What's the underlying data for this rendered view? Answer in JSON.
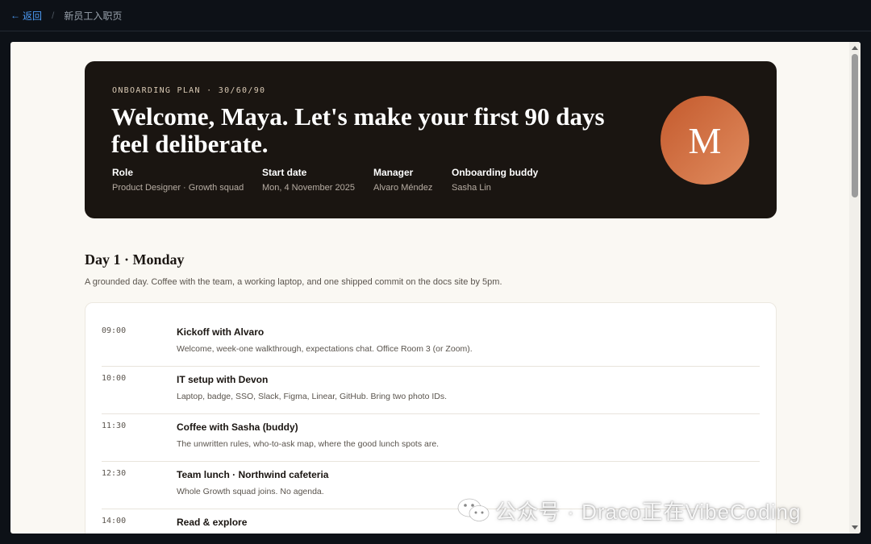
{
  "nav": {
    "back_label": "返回",
    "breadcrumb": "新员工入职页"
  },
  "hero": {
    "eyebrow": "ONBOARDING PLAN · 30/60/90",
    "title": "Welcome, Maya. Let's make your first 90 days feel deliberate.",
    "avatar_initial": "M",
    "meta": [
      {
        "label": "Role",
        "value": "Product Designer · Growth squad"
      },
      {
        "label": "Start date",
        "value": "Mon, 4 November 2025"
      },
      {
        "label": "Manager",
        "value": "Alvaro Méndez"
      },
      {
        "label": "Onboarding buddy",
        "value": "Sasha Lin"
      }
    ]
  },
  "day": {
    "title": "Day 1 · Monday",
    "subtitle": "A grounded day. Coffee with the team, a working laptop, and one shipped commit on the docs site by 5pm.",
    "events": [
      {
        "time": "09:00",
        "title": "Kickoff with Alvaro",
        "desc": "Welcome, week-one walkthrough, expectations chat. Office Room 3 (or Zoom)."
      },
      {
        "time": "10:00",
        "title": "IT setup with Devon",
        "desc": "Laptop, badge, SSO, Slack, Figma, Linear, GitHub. Bring two photo IDs."
      },
      {
        "time": "11:30",
        "title": "Coffee with Sasha (buddy)",
        "desc": "The unwritten rules, who-to-ask map, where the good lunch spots are."
      },
      {
        "time": "12:30",
        "title": "Team lunch · Northwind cafeteria",
        "desc": "Whole Growth squad joins. No agenda."
      },
      {
        "time": "14:00",
        "title": "Read & explore",
        "desc": ""
      }
    ]
  },
  "watermark": {
    "text": "公众号 · Draco正在VibeCoding",
    "icon": "wechat-icon"
  },
  "colors": {
    "accent_link": "#4c9bf5",
    "hero_bg": "#1a1511",
    "avatar_start": "#c45a2d",
    "avatar_end": "#e08c5f",
    "page_bg": "#faf8f3"
  }
}
